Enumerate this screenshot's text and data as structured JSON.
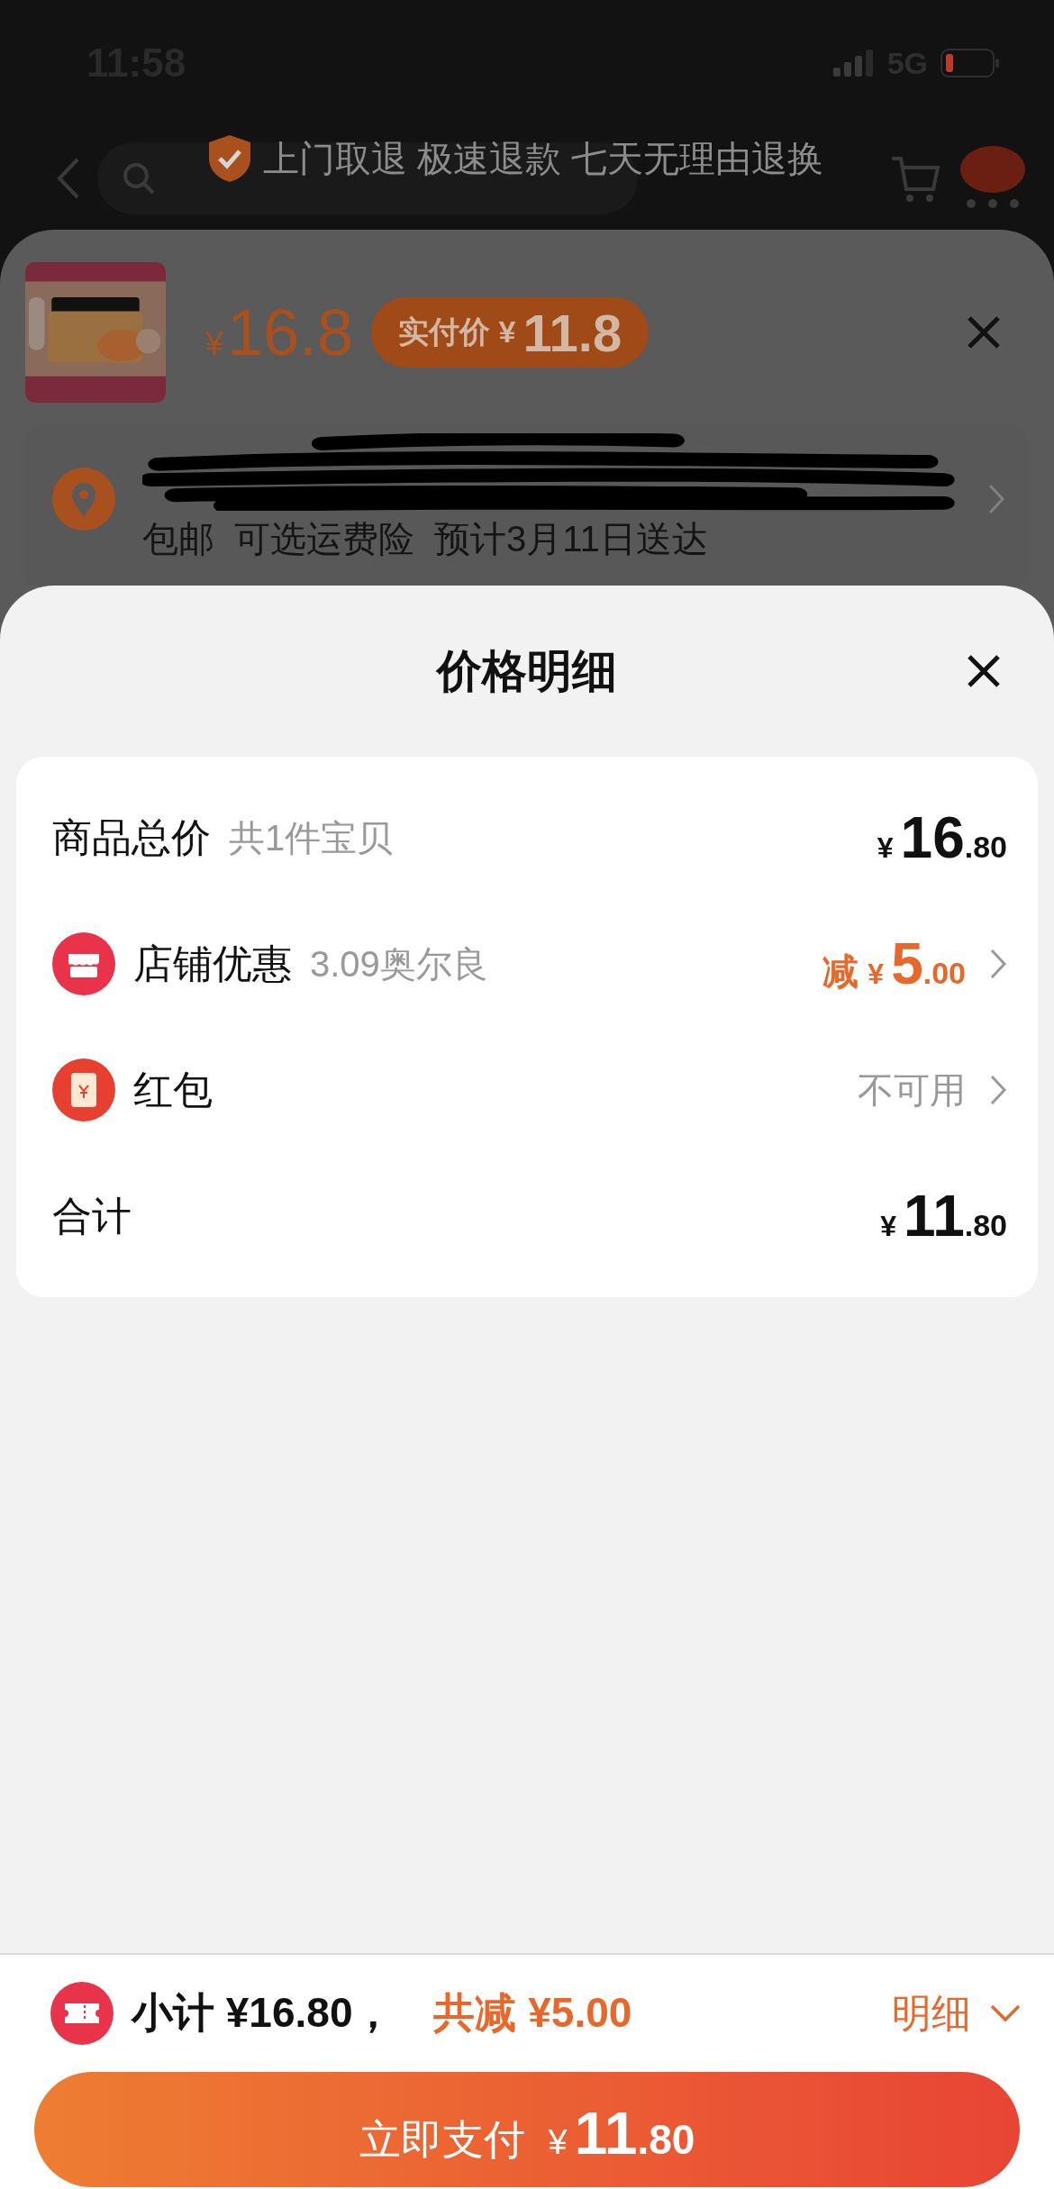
{
  "status_bar": {
    "time": "11:58",
    "network": "5G"
  },
  "nav": {
    "banner": "上门取退 极速退款 七天无理由退换"
  },
  "product": {
    "price_symbol": "¥",
    "price": "16.8",
    "actual_label": "实付价",
    "actual_symbol": "¥",
    "actual_price": "11.8"
  },
  "delivery": {
    "tags": [
      "包邮",
      "可选运费险",
      "预计3月11日送达"
    ]
  },
  "price_detail": {
    "title": "价格明细",
    "rows": [
      {
        "kind": "goods",
        "label": "商品总价",
        "note": "共1件宝贝",
        "amount": {
          "symbol": "¥",
          "integer": "16",
          "decimal": ".80"
        },
        "arrow": false
      },
      {
        "kind": "shop_discount",
        "label": "店铺优惠",
        "note": "3.09奥尔良",
        "prefix": "减",
        "amount": {
          "symbol": "¥",
          "integer": "5",
          "decimal": ".00"
        },
        "arrow": true
      },
      {
        "kind": "red_packet",
        "label": "红包",
        "status": "不可用",
        "arrow": true
      },
      {
        "kind": "sum",
        "label": "合计",
        "amount": {
          "symbol": "¥",
          "integer": "11",
          "decimal": ".80"
        },
        "arrow": false
      }
    ]
  },
  "bottom_bar": {
    "subtotal": "小计 ¥16.80，",
    "discount": "共减 ¥5.00",
    "details_link": "明细",
    "pay_button": {
      "label": "立即支付",
      "symbol": "¥",
      "integer": "11",
      "decimal": ".80"
    }
  }
}
